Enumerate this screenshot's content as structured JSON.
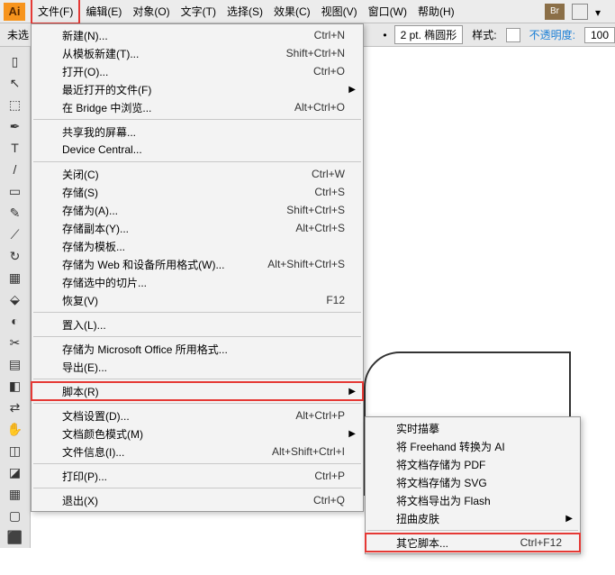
{
  "menubar": {
    "logo": "Ai",
    "items": [
      "文件(F)",
      "编辑(E)",
      "对象(O)",
      "文字(T)",
      "选择(S)",
      "效果(C)",
      "视图(V)",
      "窗口(W)",
      "帮助(H)"
    ],
    "br": "Br"
  },
  "optbar": {
    "left_label": "未选",
    "stroke_value": "2 pt. 椭圆形",
    "style_label": "样式:",
    "opacity_label": "不透明度:",
    "opacity_value": "100"
  },
  "file_menu": [
    {
      "label": "新建(N)...",
      "shortcut": "Ctrl+N"
    },
    {
      "label": "从模板新建(T)...",
      "shortcut": "Shift+Ctrl+N"
    },
    {
      "label": "打开(O)...",
      "shortcut": "Ctrl+O"
    },
    {
      "label": "最近打开的文件(F)",
      "submenu": true
    },
    {
      "label": "在 Bridge 中浏览...",
      "shortcut": "Alt+Ctrl+O"
    },
    {
      "sep": true
    },
    {
      "label": "共享我的屏幕..."
    },
    {
      "label": "Device Central..."
    },
    {
      "sep": true
    },
    {
      "label": "关闭(C)",
      "shortcut": "Ctrl+W"
    },
    {
      "label": "存储(S)",
      "shortcut": "Ctrl+S"
    },
    {
      "label": "存储为(A)...",
      "shortcut": "Shift+Ctrl+S"
    },
    {
      "label": "存储副本(Y)...",
      "shortcut": "Alt+Ctrl+S"
    },
    {
      "label": "存储为模板..."
    },
    {
      "label": "存储为 Web 和设备所用格式(W)...",
      "shortcut": "Alt+Shift+Ctrl+S"
    },
    {
      "label": "存储选中的切片..."
    },
    {
      "label": "恢复(V)",
      "shortcut": "F12"
    },
    {
      "sep": true
    },
    {
      "label": "置入(L)..."
    },
    {
      "sep": true
    },
    {
      "label": "存储为 Microsoft Office 所用格式..."
    },
    {
      "label": "导出(E)..."
    },
    {
      "sep": true
    },
    {
      "label": "脚本(R)",
      "submenu": true,
      "highlight": true
    },
    {
      "sep": true
    },
    {
      "label": "文档设置(D)...",
      "shortcut": "Alt+Ctrl+P"
    },
    {
      "label": "文档颜色模式(M)",
      "submenu": true
    },
    {
      "label": "文件信息(I)...",
      "shortcut": "Alt+Shift+Ctrl+I"
    },
    {
      "sep": true
    },
    {
      "label": "打印(P)...",
      "shortcut": "Ctrl+P"
    },
    {
      "sep": true
    },
    {
      "label": "退出(X)",
      "shortcut": "Ctrl+Q"
    }
  ],
  "script_submenu": [
    {
      "label": "实时描摹"
    },
    {
      "label": "将 Freehand 转换为 AI"
    },
    {
      "label": "将文档存储为 PDF"
    },
    {
      "label": "将文档存储为 SVG"
    },
    {
      "label": "将文档导出为 Flash"
    },
    {
      "label": "扭曲皮肤",
      "submenu": true
    },
    {
      "sep": true
    },
    {
      "label": "其它脚本...",
      "shortcut": "Ctrl+F12",
      "highlight": true
    }
  ],
  "tools": [
    "▯",
    "↖",
    "⬚",
    "✒",
    "T",
    "/",
    "▭",
    "✎",
    "⟋",
    "↻",
    "▦",
    "⬙",
    "◐",
    "✂",
    "▤",
    "◧",
    "⇄",
    "✋",
    "◫",
    "◪",
    "▦",
    "▢",
    "⬛"
  ]
}
